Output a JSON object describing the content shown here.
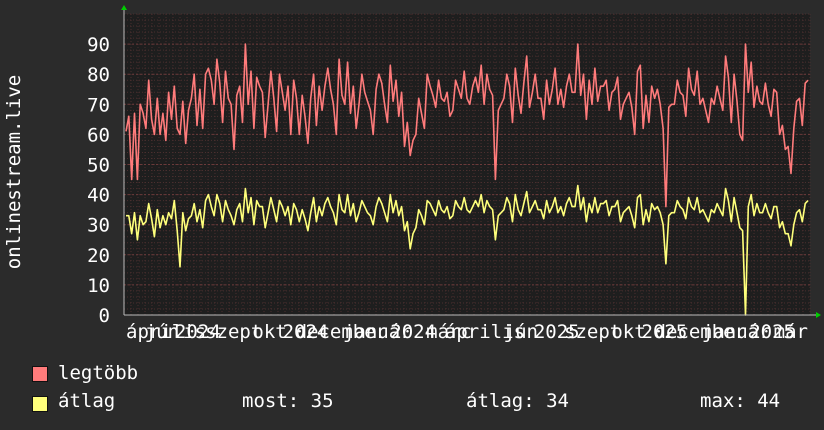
{
  "chart_data": {
    "type": "line",
    "ylabel": "onlinestream.live",
    "ylim": [
      0,
      100
    ],
    "yticks": [
      0,
      10,
      20,
      30,
      40,
      50,
      60,
      70,
      80,
      90
    ],
    "grid": true,
    "xtick_labels": [
      "április",
      "jún",
      "2024",
      "szept",
      "okt",
      "2024",
      "december",
      "január",
      "2024",
      "márc",
      "április",
      "jún",
      "2025",
      "szept",
      "okt",
      "2025",
      "december",
      "január",
      "2025",
      "már"
    ],
    "series": [
      {
        "name": "legtöbb",
        "color": "#ff7b7b",
        "values": [
          61,
          66,
          45,
          67,
          45,
          70,
          67,
          62,
          78,
          65,
          60,
          72,
          60,
          67,
          58,
          74,
          65,
          76,
          62,
          60,
          71,
          57,
          68,
          72,
          80,
          63,
          75,
          62,
          80,
          82,
          78,
          70,
          85,
          77,
          64,
          81,
          72,
          70,
          55,
          73,
          76,
          64,
          90,
          70,
          81,
          62,
          79,
          76,
          74,
          59,
          70,
          81,
          72,
          61,
          80,
          74,
          68,
          76,
          60,
          78,
          72,
          60,
          73,
          66,
          57,
          72,
          80,
          63,
          76,
          68,
          76,
          82,
          75,
          70,
          60,
          85,
          73,
          70,
          84,
          67,
          76,
          62,
          70,
          80,
          74,
          71,
          68,
          60,
          75,
          80,
          77,
          70,
          64,
          83,
          71,
          78,
          66,
          74,
          56,
          64,
          53,
          58,
          60,
          72,
          67,
          62,
          80,
          76,
          73,
          69,
          78,
          72,
          71,
          74,
          66,
          68,
          78,
          75,
          72,
          81,
          72,
          70,
          76,
          79,
          74,
          83,
          70,
          80,
          75,
          73,
          45,
          68,
          70,
          72,
          80,
          76,
          64,
          82,
          73,
          67,
          77,
          86,
          69,
          74,
          80,
          72,
          72,
          65,
          78,
          70,
          75,
          82,
          70,
          75,
          69,
          76,
          80,
          74,
          74,
          90,
          73,
          80,
          65,
          78,
          70,
          82,
          71,
          76,
          76,
          78,
          68,
          74,
          75,
          79,
          65,
          70,
          72,
          74,
          69,
          60,
          81,
          83,
          62,
          73,
          64,
          76,
          72,
          75,
          70,
          62,
          36,
          69,
          70,
          70,
          78,
          74,
          73,
          66,
          82,
          75,
          73,
          81,
          70,
          72,
          68,
          64,
          72,
          70,
          76,
          72,
          68,
          86,
          79,
          64,
          80,
          71,
          60,
          58,
          90,
          74,
          84,
          69,
          76,
          71,
          70,
          77,
          70,
          66,
          75,
          74,
          60,
          63,
          55,
          56,
          47,
          62,
          71,
          72,
          63,
          77,
          78
        ]
      },
      {
        "name": "átlag",
        "color": "#ffff7b",
        "values": [
          33,
          33,
          27,
          34,
          25,
          33,
          30,
          31,
          37,
          32,
          26,
          35,
          29,
          33,
          30,
          34,
          32,
          38,
          28,
          16,
          34,
          28,
          32,
          33,
          37,
          31,
          35,
          29,
          38,
          40,
          36,
          33,
          40,
          37,
          31,
          38,
          35,
          33,
          30,
          35,
          37,
          31,
          42,
          34,
          39,
          30,
          38,
          36,
          36,
          29,
          34,
          39,
          35,
          31,
          38,
          36,
          33,
          36,
          30,
          37,
          35,
          31,
          35,
          32,
          28,
          34,
          39,
          31,
          36,
          33,
          37,
          39,
          36,
          34,
          30,
          40,
          35,
          34,
          40,
          33,
          37,
          31,
          34,
          38,
          36,
          34,
          33,
          30,
          36,
          39,
          37,
          34,
          31,
          40,
          34,
          38,
          33,
          36,
          28,
          31,
          22,
          27,
          29,
          35,
          33,
          30,
          38,
          37,
          35,
          33,
          38,
          35,
          34,
          36,
          32,
          33,
          38,
          36,
          35,
          39,
          35,
          34,
          36,
          38,
          36,
          40,
          34,
          38,
          36,
          35,
          25,
          33,
          34,
          35,
          39,
          37,
          31,
          40,
          35,
          33,
          37,
          41,
          34,
          36,
          38,
          35,
          35,
          32,
          38,
          34,
          36,
          39,
          34,
          36,
          33,
          37,
          39,
          36,
          36,
          43,
          35,
          39,
          31,
          37,
          34,
          39,
          34,
          37,
          37,
          38,
          33,
          36,
          36,
          38,
          31,
          34,
          35,
          36,
          33,
          29,
          39,
          40,
          30,
          35,
          31,
          37,
          35,
          36,
          34,
          30,
          17,
          33,
          34,
          34,
          38,
          36,
          35,
          32,
          39,
          36,
          35,
          39,
          34,
          35,
          33,
          31,
          35,
          34,
          37,
          35,
          33,
          42,
          38,
          31,
          39,
          34,
          29,
          28,
          0,
          36,
          40,
          33,
          37,
          34,
          34,
          37,
          34,
          32,
          36,
          36,
          29,
          31,
          27,
          27,
          23,
          30,
          34,
          35,
          31,
          37,
          38
        ]
      }
    ]
  },
  "legend": {
    "max_label": "legtöbb",
    "avg_label": "átlag"
  },
  "stats": {
    "now": "most: 35",
    "avg": "átlag: 34",
    "max": "max: 44"
  }
}
